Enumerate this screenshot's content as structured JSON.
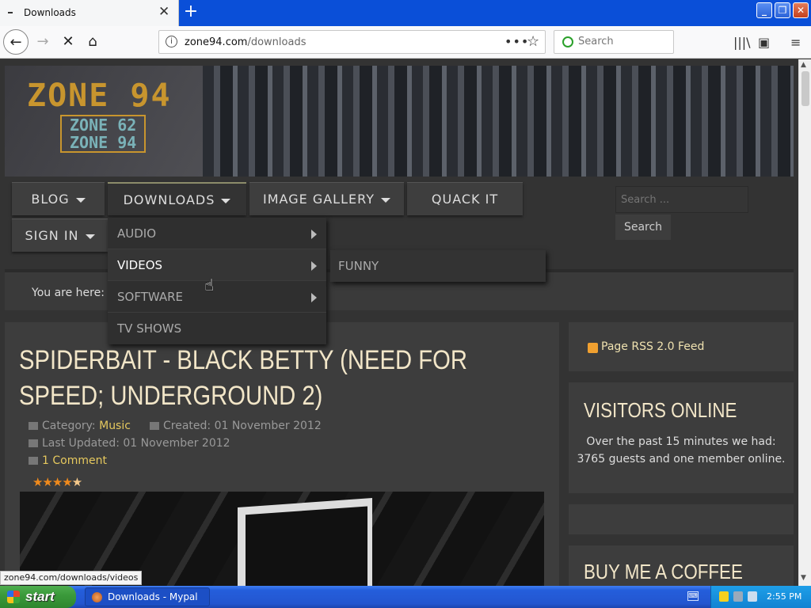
{
  "browser": {
    "tab_title": "Downloads",
    "url_host": "zone94.com",
    "url_path": "/downloads",
    "search_placeholder": "Search",
    "status_url": "zone94.com/downloads/videos"
  },
  "site": {
    "logo_main": "ZONE 94",
    "logo_sub1": "ZONE 62",
    "logo_sub2": "ZONE 94",
    "menu": {
      "blog": "BLOG",
      "downloads": "DOWNLOADS",
      "gallery": "IMAGE GALLERY",
      "quack": "QUACK IT",
      "signin": "SIGN IN"
    },
    "search_placeholder": "Search ...",
    "search_button": "Search",
    "dropdown": [
      "AUDIO",
      "VIDEOS",
      "SOFTWARE",
      "TV SHOWS"
    ],
    "submenu": "FUNNY",
    "breadcrumb": "You are here:"
  },
  "article": {
    "title": "SPIDERBAIT - BLACK BETTY (NEED FOR SPEED; UNDERGROUND 2)",
    "category_label": "Category:",
    "category": "Music",
    "created": "Created: 01 November 2012",
    "updated": "Last Updated: 01 November 2012",
    "comments": "1 Comment",
    "rating": 4.5
  },
  "sidebar": {
    "rss": "Page RSS 2.0 Feed",
    "visitors_title": "VISITORS ONLINE",
    "visitors_text": "Over the past 15 minutes we had: 3765 guests and one member online.",
    "coffee_title": "BUY ME A COFFEE"
  },
  "taskbar": {
    "start": "start",
    "window": "Downloads - Mypal",
    "clock": "2:55 PM"
  },
  "colors": {
    "accent": "#e5c85e",
    "title": "#f2e6c8",
    "taskbar": "#245edb",
    "start": "#3b9a3b"
  }
}
